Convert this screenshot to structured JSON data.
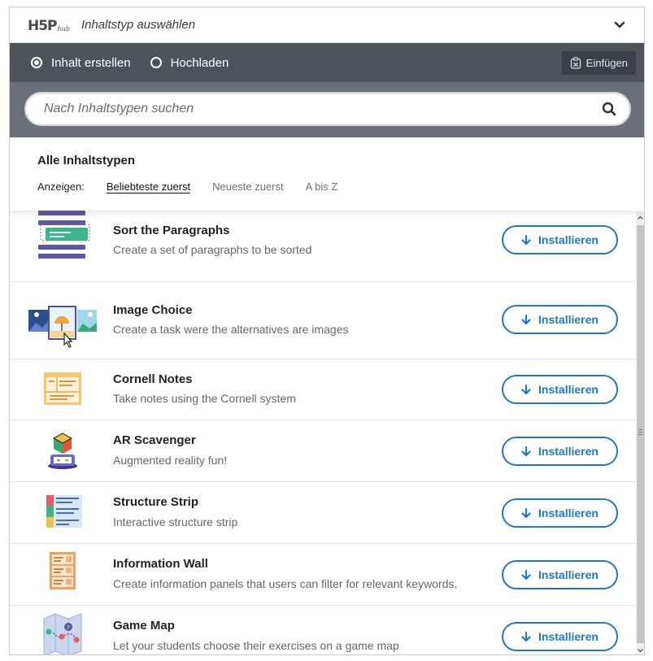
{
  "header": {
    "logo_main": "H5P",
    "logo_sub": "hub",
    "title": "Inhaltstyp auswählen"
  },
  "tabs": {
    "create_label": "Inhalt erstellen",
    "upload_label": "Hochladen",
    "selected": "create",
    "paste_label": "Einfügen"
  },
  "search": {
    "placeholder": "Nach Inhaltstypen suchen"
  },
  "results": {
    "title": "Alle Inhaltstypen",
    "show_label": "Anzeigen:",
    "sort_options": [
      "Beliebteste zuerst",
      "Neueste zuerst",
      "A bis Z"
    ],
    "active_sort": "Beliebteste zuerst"
  },
  "install_label": "Installieren",
  "accent_color": "#1f78c2",
  "items": [
    {
      "name": "Sort the Paragraphs",
      "description": "Create a set of paragraphs to be sorted",
      "icon": "sort-paragraphs-icon"
    },
    {
      "name": "Image Choice",
      "description": "Create a task were the alternatives are images",
      "icon": "image-choice-icon"
    },
    {
      "name": "Cornell Notes",
      "description": "Take notes using the Cornell system",
      "icon": "cornell-notes-icon"
    },
    {
      "name": "AR Scavenger",
      "description": "Augmented reality fun!",
      "icon": "ar-scavenger-icon"
    },
    {
      "name": "Structure Strip",
      "description": "Interactive structure strip",
      "icon": "structure-strip-icon"
    },
    {
      "name": "Information Wall",
      "description": "Create information panels that users can filter for relevant keywords.",
      "icon": "information-wall-icon"
    },
    {
      "name": "Game Map",
      "description": "Let your students choose their exercises on a game map",
      "icon": "game-map-icon"
    }
  ]
}
